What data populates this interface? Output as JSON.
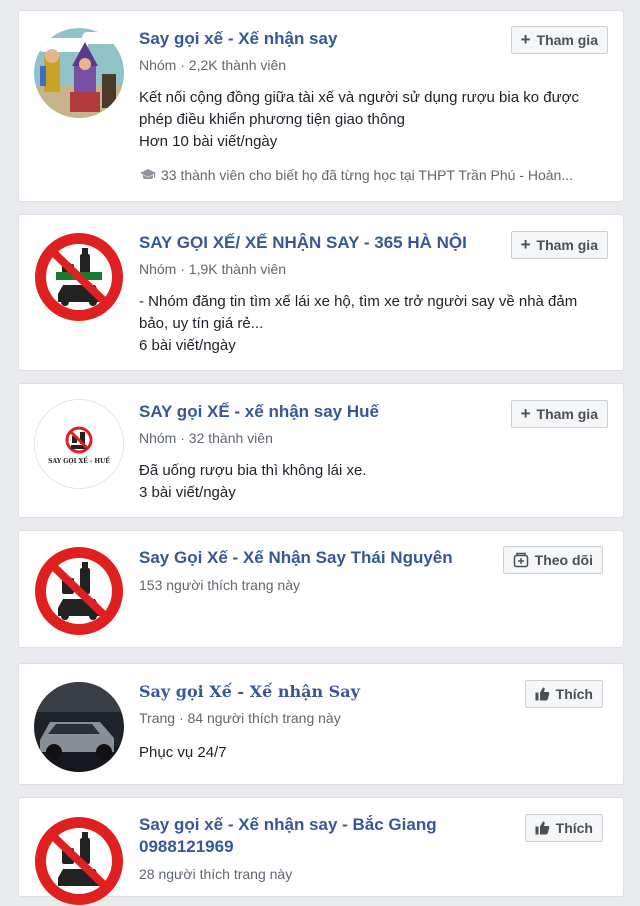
{
  "results": [
    {
      "title": "Say gọi xế - Xế nhận say",
      "meta": "Nhóm · 2,2K thành viên",
      "desc_line1": "Kết nối cộng đồng giữa tài xế và người sử dụng rượu bia ko được",
      "desc_line2": "phép điều khiển phương tiện giao thông",
      "posts": "Hơn 10 bài viết/ngày",
      "note": "33 thành viên cho biết họ đã từng học tại THPT Trần Phú - Hoàn...",
      "button": "Tham gia",
      "button_icon": "plus-icon"
    },
    {
      "title": "SAY GỌI XẾ/ XẾ NHẬN SAY - 365 HÀ NỘI",
      "meta": "Nhóm · 1,9K thành viên",
      "desc_line1": "- Nhóm đăng tin tìm xế lái xe hộ, tìm xe trở người say về nhà đảm",
      "desc_line2": "bảo, uy tín giá rẻ...",
      "posts": "6 bài viết/ngày",
      "button": "Tham gia",
      "button_icon": "plus-icon"
    },
    {
      "title": "SAY gọi XẾ - xế nhận say Huế",
      "meta": "Nhóm · 32 thành viên",
      "desc_line1": "Đã uống rượu bia thì không lái xe.",
      "posts": "3 bài viết/ngày",
      "logo_caption": "SAY GỌI XẾ - HUẾ",
      "button": "Tham gia",
      "button_icon": "plus-icon"
    },
    {
      "title": "Say Gọi Xế - Xế Nhận Say Thái Nguyên",
      "meta": "153 người thích trang này",
      "button": "Theo dõi",
      "button_icon": "follow-icon"
    },
    {
      "title": "Say gọi Xế - Xế nhận Say",
      "meta": "Trang · 84 người thích trang này",
      "desc_line1": "Phục vụ 24/7",
      "button": "Thích",
      "button_icon": "like-icon"
    },
    {
      "title": "Say gọi xế - Xế nhận say - Bắc Giang",
      "title_line2": "0988121969",
      "meta": "28 người thích trang này",
      "button": "Thích",
      "button_icon": "like-icon"
    }
  ],
  "colors": {
    "title": "#365899",
    "background": "#e9ebee",
    "sign_red": "#e02020",
    "meta": "#606770"
  }
}
